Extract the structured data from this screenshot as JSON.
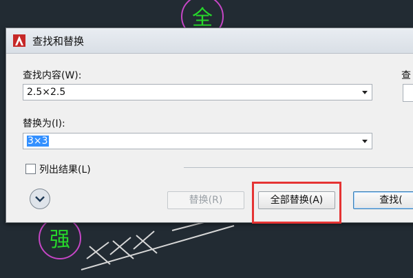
{
  "canvas": {
    "text_top": "全",
    "text_bottom": "强",
    "colors": {
      "background": "#222b33",
      "circle": "#c646c6",
      "glyph": "#27d72b",
      "hatch": "#d8d8d8"
    }
  },
  "dialog": {
    "title": "查找和替换",
    "find_label": "查找内容(W):",
    "find_value": "2.5×2.5",
    "replace_label": "替换为(I):",
    "replace_value": "3×3",
    "list_results_label": "列出结果(L)",
    "list_results_checked": false,
    "right_partial_label": "查",
    "buttons": {
      "replace": "替换(R)",
      "replace_all": "全部替换(A)",
      "find": "查找("
    }
  },
  "icons": {
    "app": "autocad-logo-icon",
    "expand": "chevron-down-icon",
    "dropdown": "caret-down-icon"
  },
  "colors": {
    "highlight_box": "#e53333",
    "selection": "#3390ff"
  }
}
